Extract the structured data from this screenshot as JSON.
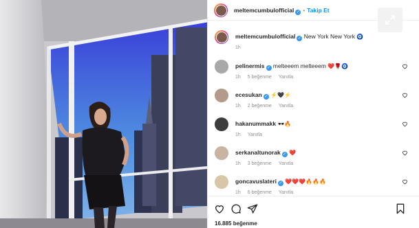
{
  "post": {
    "username": "meltemcumbulofficial",
    "follow_label": "Takip Et",
    "separator": "•",
    "caption": "New York New York",
    "caption_emoji": "🧿",
    "caption_time": "1h",
    "likes": "16.885 beğenme"
  },
  "comments": [
    {
      "user": "pelinermis",
      "verified": true,
      "text": "melteeem melteeem",
      "emoji": "❤️🌹🧿",
      "time": "1h",
      "likes": "5 beğenme",
      "reply": "Yanıtla"
    },
    {
      "user": "ecesukan",
      "verified": true,
      "text": "",
      "emoji": "⚡🖤⚡",
      "time": "1h",
      "likes": "2 beğenme",
      "reply": "Yanıtla"
    },
    {
      "user": "hakanummakk",
      "verified": false,
      "text": "",
      "emoji": "🕶️🔥",
      "time": "1h",
      "likes": "",
      "reply": "Yanıtla"
    },
    {
      "user": "serkanaltunorak",
      "verified": true,
      "text": "",
      "emoji": "❤️",
      "time": "1h",
      "likes": "3 beğenme",
      "reply": "Yanıtla"
    },
    {
      "user": "goncavuslateri",
      "verified": true,
      "text": "",
      "emoji": "❤️❤️❤️🔥🔥🔥",
      "time": "1h",
      "likes": "6 beğenme",
      "reply": "Yanıtla"
    }
  ],
  "icons": {
    "like": "heart-icon",
    "comment": "comment-icon",
    "share": "share-icon",
    "save": "bookmark-icon",
    "expand": "expand-icon",
    "verified": "verified-badge-icon"
  },
  "colors": {
    "link": "#0095f6",
    "verified": "#3897f0",
    "muted": "#8e8e8e",
    "text": "#262626"
  }
}
